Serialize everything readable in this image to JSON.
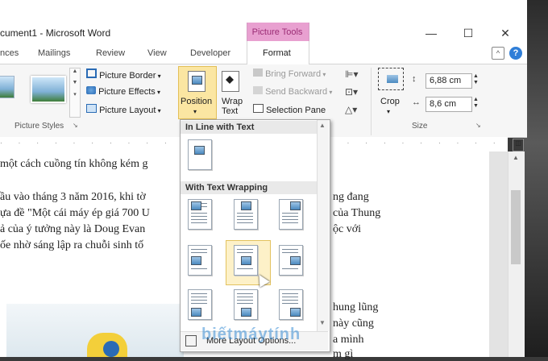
{
  "window": {
    "title": "cument1 - Microsoft Word",
    "minimize": "—",
    "maximize": "☐",
    "close": "✕"
  },
  "contextual_tab": "Picture Tools",
  "tabs": [
    "nces",
    "Mailings",
    "Review",
    "View",
    "Developer",
    "Format"
  ],
  "ribbon": {
    "picture_styles_label": "Picture Styles",
    "picture_border": "Picture Border",
    "picture_effects": "Picture Effects",
    "picture_layout": "Picture Layout",
    "position": "Position",
    "wrap_text_line1": "Wrap",
    "wrap_text_line2": "Text",
    "bring_forward": "Bring Forward",
    "send_backward": "Send Backward",
    "selection_pane": "Selection Pane",
    "crop": "Crop",
    "height_value": "6,88 cm",
    "width_value": "8,6 cm",
    "size_label": "Size"
  },
  "dropdown": {
    "section_inline": "In Line with Text",
    "section_wrap": "With Text Wrapping",
    "more_options": "More Layout Options..."
  },
  "document": {
    "lines": [
      "một cách cuồng tín không kém g",
      "ầu vào tháng 3 năm 2016, khi tờ",
      "ựa đề \"Một cái máy ép giá 700 U",
      "ả của ý tưởng này là Doug Evan",
      "ốe nhờ sáng lập ra chuỗi sinh tố"
    ],
    "right_lines": [
      "ng đang",
      "của Thung",
      "ộc với"
    ],
    "lower_right": [
      "hung lũng",
      "này cũng",
      "a mình",
      "m gì"
    ]
  },
  "watermark": "biếtmáytính"
}
